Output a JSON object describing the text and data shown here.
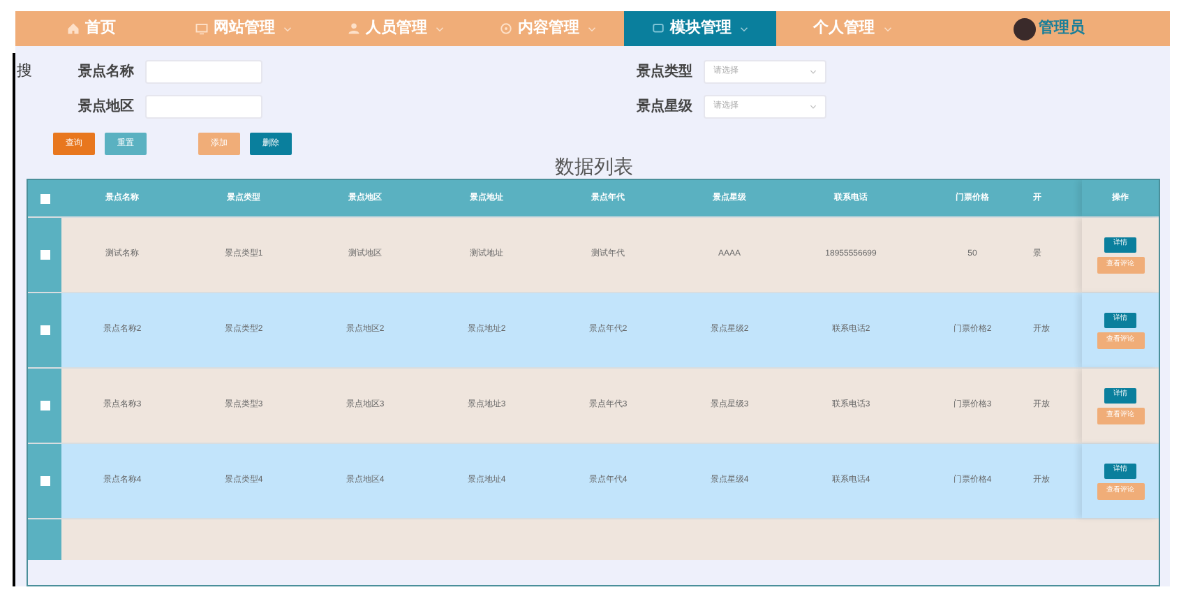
{
  "nav": [
    {
      "label": "首页",
      "selected": false,
      "caret": false
    },
    {
      "label": "网站管理",
      "selected": false,
      "caret": true
    },
    {
      "label": "人员管理",
      "selected": false,
      "caret": true
    },
    {
      "label": "内容管理",
      "selected": false,
      "caret": true
    },
    {
      "label": "模块管理",
      "selected": true,
      "caret": true
    },
    {
      "label": "个人管理",
      "selected": false,
      "caret": true
    }
  ],
  "user": {
    "name": "管理员"
  },
  "side_label": "搜",
  "filters": [
    {
      "label": "景点名称",
      "kind": "input"
    },
    {
      "label": "景点类型",
      "kind": "select",
      "placeholder": "请选择"
    },
    {
      "label": "景点地区",
      "kind": "input"
    },
    {
      "label": "景点星级",
      "kind": "select",
      "placeholder": "请选择"
    }
  ],
  "buttons": [
    {
      "label": "查询",
      "kind": "query"
    },
    {
      "label": "重置",
      "kind": "reset"
    },
    {
      "label": "添加",
      "kind": "add"
    },
    {
      "label": "删除",
      "kind": "delete"
    }
  ],
  "table": {
    "title": "数据列表",
    "columns": [
      "景点名称",
      "景点类型",
      "景点地区",
      "景点地址",
      "景点年代",
      "景点星级",
      "联系电话",
      "门票价格",
      "开"
    ],
    "action_column": "操作",
    "rows": [
      {
        "cells": [
          "测试名称",
          "景点类型1",
          "测试地区",
          "测试地址",
          "测试年代",
          "AAAA",
          "18955556699",
          "50",
          "景"
        ],
        "checked": false,
        "actions": [
          "详情",
          "查看评论"
        ]
      },
      {
        "cells": [
          "景点名称2",
          "景点类型2",
          "景点地区2",
          "景点地址2",
          "景点年代2",
          "景点星级2",
          "联系电话2",
          "门票价格2",
          "开放"
        ],
        "checked": false,
        "actions": [
          "详情",
          "查看评论"
        ]
      },
      {
        "cells": [
          "景点名称3",
          "景点类型3",
          "景点地区3",
          "景点地址3",
          "景点年代3",
          "景点星级3",
          "联系电话3",
          "门票价格3",
          "开放"
        ],
        "checked": false,
        "actions": [
          "详情",
          "查看评论"
        ]
      },
      {
        "cells": [
          "景点名称4",
          "景点类型4",
          "景点地区4",
          "景点地址4",
          "景点年代4",
          "景点星级4",
          "联系电话4",
          "门票价格4",
          "开放"
        ],
        "checked": false,
        "actions": [
          "详情",
          "查看评论"
        ]
      }
    ],
    "header_checked": false
  }
}
